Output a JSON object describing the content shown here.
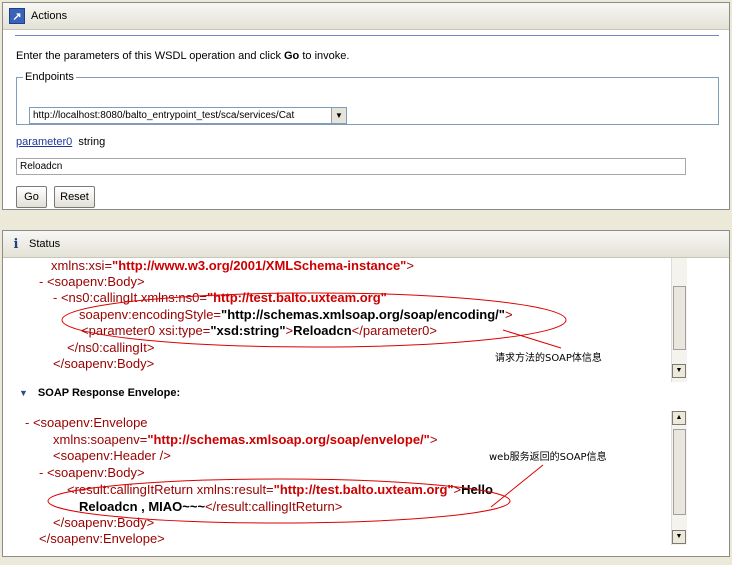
{
  "actions": {
    "title": "Actions",
    "instruction_pre": "Enter the parameters of this WSDL operation and click ",
    "instruction_bold": "Go",
    "instruction_post": " to invoke.",
    "endpoints_legend": "Endpoints",
    "endpoint_value": "http://localhost:8080/balto_entrypoint_test/sca/services/Cat",
    "param_name": "parameter0",
    "param_type": "string",
    "param_value": "Reloadcn",
    "go_label": "Go",
    "reset_label": "Reset"
  },
  "status": {
    "title": "Status",
    "request_lines": {
      "l1_attr": "xmlns:xsi=",
      "l1_val": "\"http://www.w3.org/2001/XMLSchema-instance\"",
      "l1_end": ">",
      "l2_minus": "-",
      "l2_tag": "<soapenv:Body>",
      "l3_minus": "-",
      "l3_tag": "<ns0:callingIt",
      "l3_attr": " xmlns:ns0=",
      "l3_val": "\"http://test.balto.uxteam.org\"",
      "l4_attr": "soapenv:encodingStyle=",
      "l4_val": "\"http://schemas.xmlsoap.org/soap/encoding/\"",
      "l4_end": ">",
      "l5_tag": "<parameter0",
      "l5_attr": " xsi:type=",
      "l5_val": "\"xsd:string\"",
      "l5_gt": ">",
      "l5_text": "Reloadcn",
      "l5_close": "</parameter0>",
      "l6_tag": "</ns0:callingIt>",
      "l7_tag": "</soapenv:Body>"
    },
    "request_annotation": "请求方法的SOAP体信息",
    "response_heading": "SOAP Response Envelope:",
    "response_lines": {
      "r1_minus": "-",
      "r1_tag": "<soapenv:Envelope",
      "r2_attr": "xmlns:soapenv=",
      "r2_val": "\"http://schemas.xmlsoap.org/soap/envelope/\"",
      "r2_end": ">",
      "r3_tag": "<soapenv:Header />",
      "r4_minus": "-",
      "r4_tag": "<soapenv:Body>",
      "r5_tag": "<result:callingItReturn",
      "r5_attr": " xmlns:result=",
      "r5_val": "\"http://test.balto.uxteam.org\"",
      "r5_gt": ">",
      "r5_text": "Hello",
      "r6_text": "Reloadcn , MIAO~~~",
      "r6_close": "</result:callingItReturn>",
      "r7_tag": "</soapenv:Body>",
      "r8_tag": "</soapenv:Envelope>"
    },
    "response_annotation": "web服务返回的SOAP信息"
  }
}
